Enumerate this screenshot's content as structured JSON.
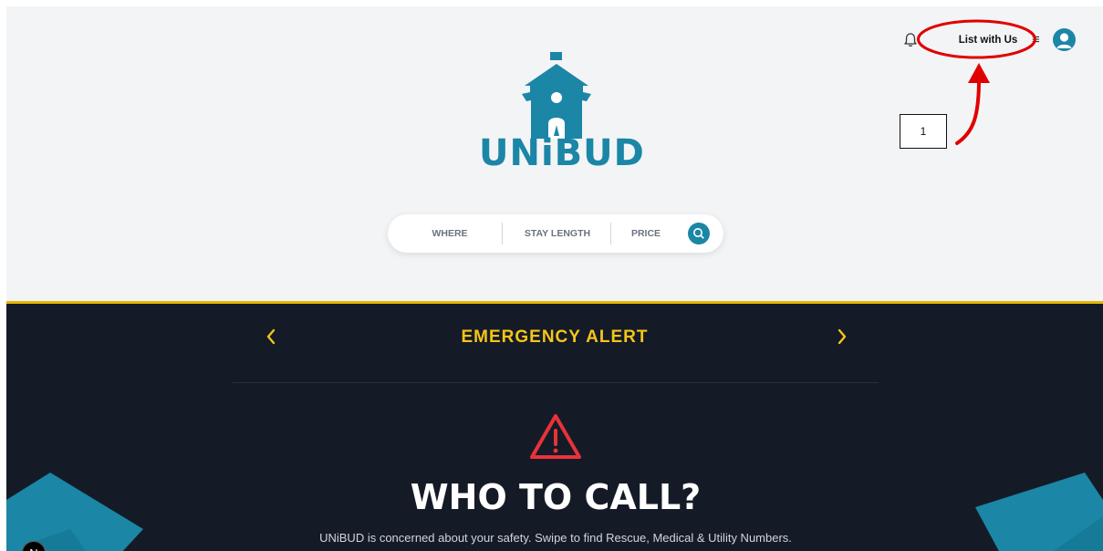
{
  "header": {
    "notifications_icon": "bell-icon",
    "list_with_us_label": "List with Us",
    "menu_icon": "hamburger-icon",
    "menu_glyph": "≡",
    "profile_icon": "user-avatar-icon"
  },
  "logo": {
    "text": "UNiBUD",
    "color": "#1b86a6"
  },
  "search": {
    "where_label": "WHERE",
    "stay_length_label": "STAY LENGTH",
    "price_label": "PRICE",
    "search_icon": "search-icon"
  },
  "annotation": {
    "step_number": "1",
    "color": "#e00000"
  },
  "emergency": {
    "prev_icon": "chevron-left-icon",
    "title": "EMERGENCY ALERT",
    "next_icon": "chevron-right-icon",
    "warning_icon": "warning-triangle-icon",
    "headline": "WHO TO CALL?",
    "description": "UNiBUD is concerned about your safety. Swipe to find Rescue, Medical & Utility Numbers.",
    "accent_color": "#f5c518",
    "background_color": "#141b27"
  },
  "dev_badge": {
    "letter": "N"
  }
}
